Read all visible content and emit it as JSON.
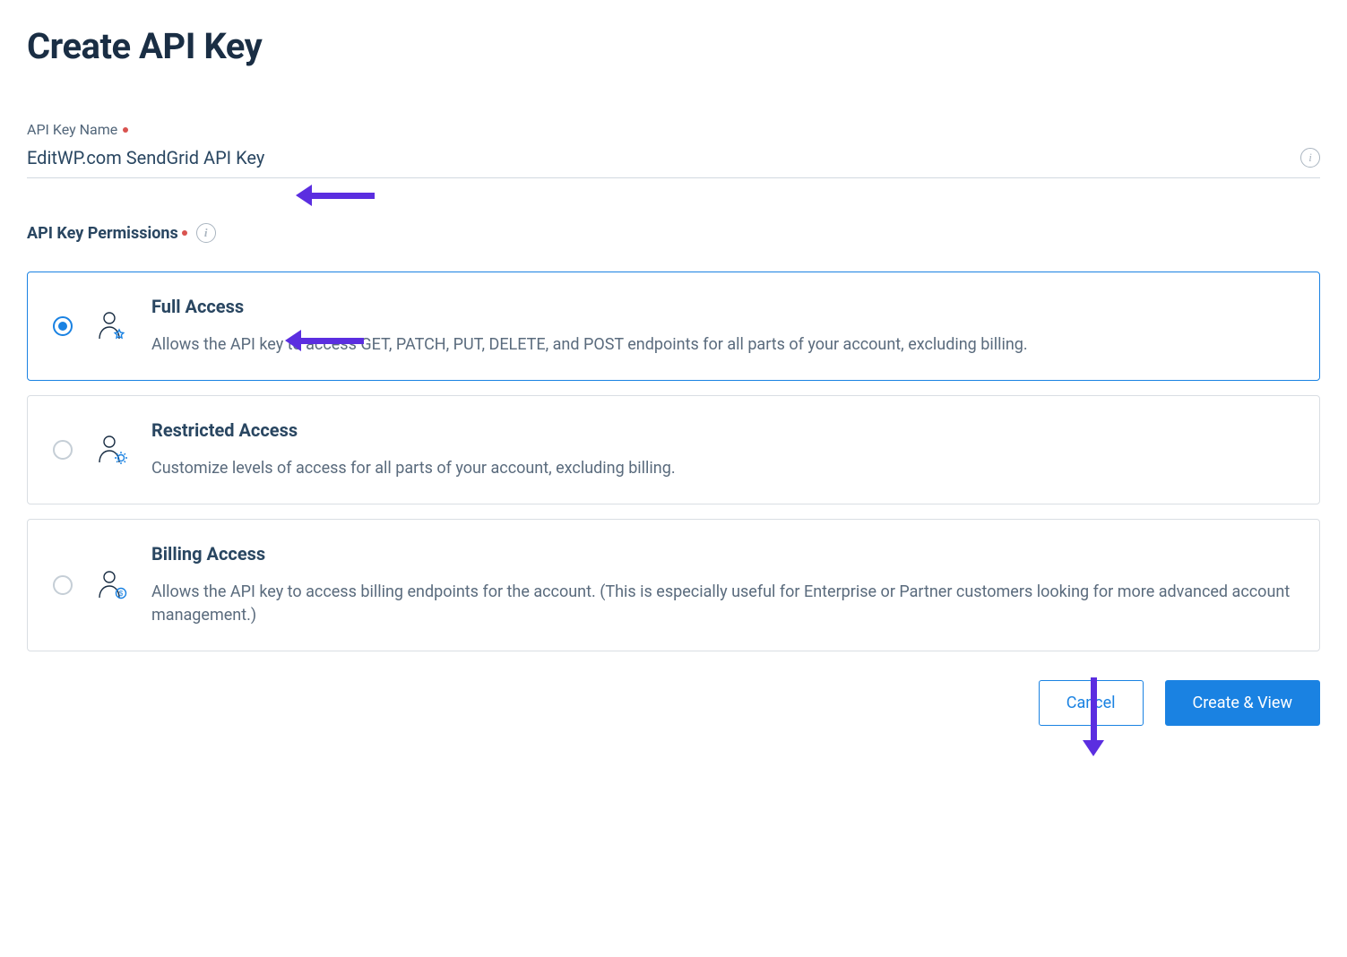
{
  "page": {
    "title": "Create API Key"
  },
  "field": {
    "name_label": "API Key Name",
    "name_value": "EditWP.com SendGrid API Key"
  },
  "permissions": {
    "section_label": "API Key Permissions",
    "options": [
      {
        "id": "full",
        "title": "Full Access",
        "description": "Allows the API key to access GET, PATCH, PUT, DELETE, and POST endpoints for all parts of your account, excluding billing.",
        "selected": true
      },
      {
        "id": "restricted",
        "title": "Restricted Access",
        "description": "Customize levels of access for all parts of your account, excluding billing.",
        "selected": false
      },
      {
        "id": "billing",
        "title": "Billing Access",
        "description": "Allows the API key to access billing endpoints for the account. (This is especially useful for Enterprise or Partner customers looking for more advanced account management.)",
        "selected": false
      }
    ]
  },
  "actions": {
    "cancel_label": "Cancel",
    "submit_label": "Create & View"
  },
  "colors": {
    "primary": "#1a82e2",
    "annotation": "#5b2ee0"
  }
}
